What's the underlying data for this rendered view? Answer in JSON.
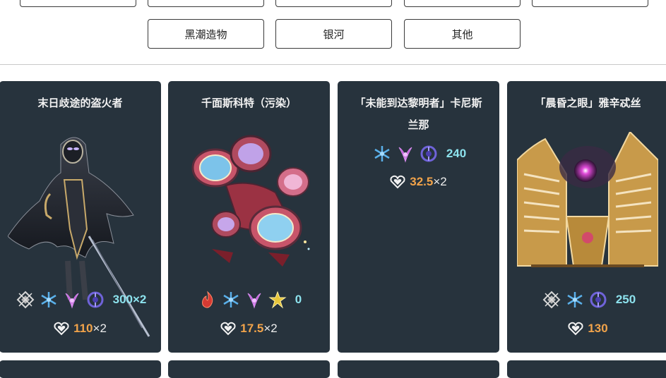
{
  "filters": {
    "row2": [
      "黑潮造物",
      "银河",
      "其他"
    ]
  },
  "cards": [
    {
      "title_lines": [
        "末日歧途的盗火者"
      ],
      "elements": [
        "imaginary-icon",
        "ice-icon",
        "wind-icon",
        "quantum-icon"
      ],
      "toughness": "300×2",
      "hp_value": "110",
      "hp_multiplier": "×2"
    },
    {
      "title_lines": [
        "千面斯科特（污染）"
      ],
      "elements": [
        "fire-icon",
        "ice-icon",
        "wind-icon",
        "lightning-icon"
      ],
      "toughness": "0",
      "hp_value": "17.5",
      "hp_multiplier": "×2"
    },
    {
      "title_lines": [
        "「未能到达黎明者」卡尼斯",
        "兰那"
      ],
      "elements": [
        "ice-icon",
        "wind-icon",
        "quantum-icon"
      ],
      "toughness": "240",
      "hp_value": "32.5",
      "hp_multiplier": "×2"
    },
    {
      "title_lines": [
        "「晨昏之眼」雅辛忒丝"
      ],
      "elements": [
        "imaginary-icon",
        "ice-icon",
        "quantum-icon"
      ],
      "toughness": "250",
      "hp_value": "130",
      "hp_multiplier": ""
    }
  ],
  "colors": {
    "card_bg": "#27333d",
    "toughness": "#8de3ee",
    "hp": "#f1a34a"
  }
}
